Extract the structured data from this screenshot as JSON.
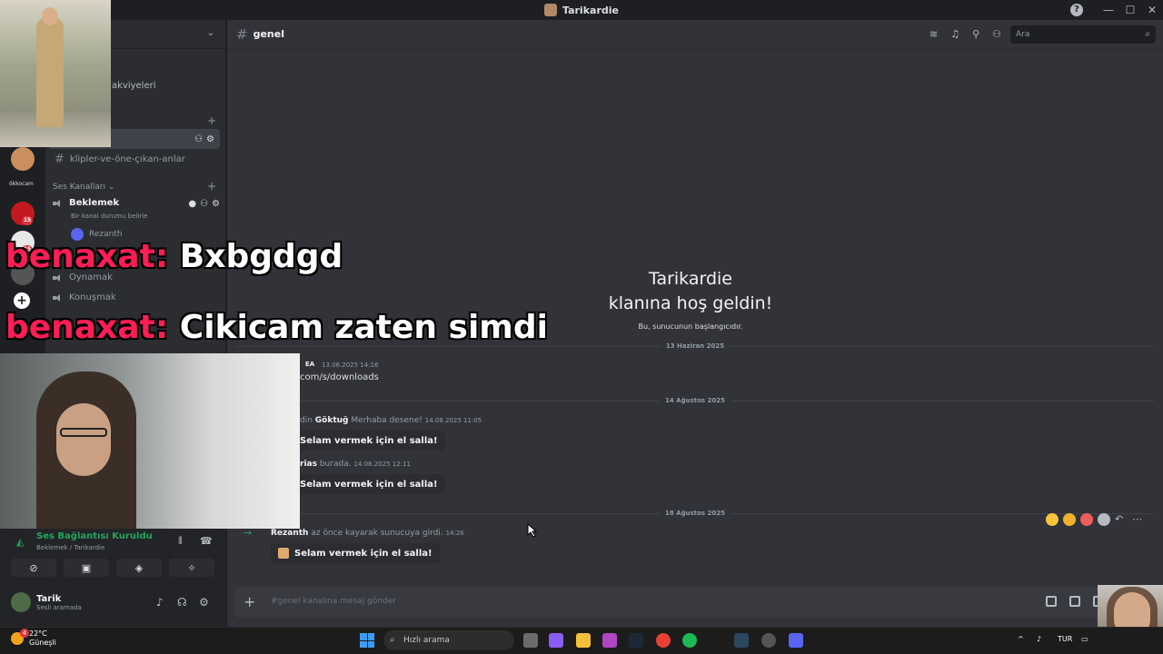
{
  "window": {
    "title": "Tarikardie",
    "controls": [
      "—",
      "☐",
      "✕"
    ]
  },
  "sidebar": {
    "boosts_fragment": "akviyeleri",
    "text_channels": [
      {
        "name": "klipler-ve-öne-çıkan-anlar"
      }
    ],
    "voice_category": "Ses Kanalları",
    "voice_channels": [
      {
        "name": "Beklemek",
        "status": "Bir kanal durumu belirle",
        "users": [
          "Rezanth"
        ]
      },
      {
        "name": "Oynamak"
      },
      {
        "name": "Konuşmak"
      }
    ],
    "rail_label": "ökkocam",
    "badges": [
      "15",
      "15"
    ]
  },
  "voice_panel": {
    "status": "Ses Bağlantısı Kuruldu",
    "location": "Beklemek / Tarikardie",
    "user_name": "Tarik",
    "user_status": "Sesli aramada"
  },
  "header": {
    "channel": "genel",
    "search_placeholder": "Ara"
  },
  "welcome": {
    "title_line1": "Tarikardie",
    "title_line2": "klanına hoş geldin!",
    "subtitle": "Bu, sunucunun başlangıcıdır."
  },
  "messages": {
    "divider1": "13 Haziran 2025",
    "m1_tag": "EA",
    "m1_time": "13.06.2025 14:16",
    "m1_link": "com/s/downloads",
    "divider2": "14 Ağustos 2025",
    "m2_prefix": "din",
    "m2_user": "Göktuğ",
    "m2_text": "Merhaba desene!",
    "m2_time": "14.08.2025 11:05",
    "wave_label": "Selam vermek için el salla!",
    "m3_user": "rias",
    "m3_text": "burada.",
    "m3_time": "14.08.2025 12:11",
    "divider3": "18 Ağustos 2025",
    "m4_user": "Rezanth",
    "m4_text": "az önce kayarak sunucuya girdi.",
    "m4_time": "14:26"
  },
  "composer": {
    "placeholder": "#genel kanalına mesaj gönder"
  },
  "overlay_chat": [
    {
      "user": "benaxat:",
      "text": "Bxbgdgd"
    },
    {
      "user": "benaxat:",
      "text": "Cikicam zaten simdi"
    }
  ],
  "taskbar": {
    "temp": "22°C",
    "weather": "Güneşli",
    "search": "Hızlı arama",
    "lang": "TUR",
    "notif_badge": "4"
  },
  "colors": {
    "accent": "#5865f2",
    "green": "#23a55a",
    "overlay_user": "#ff1d55"
  }
}
